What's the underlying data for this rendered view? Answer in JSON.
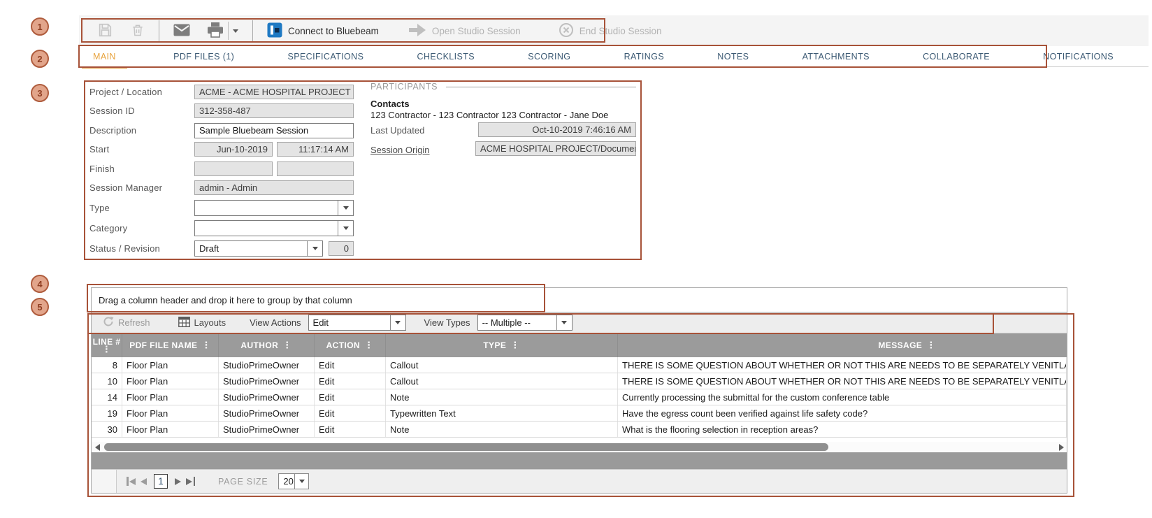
{
  "colors": {
    "accent_orange": "#E8A33D",
    "annotation_brown": "#A75238",
    "tab_inactive": "#3C5A74",
    "bluebeam_blue": "#1E79C3",
    "grid_header_gray": "#9B9B9B"
  },
  "callouts": [
    "1",
    "2",
    "3",
    "4",
    "5"
  ],
  "top_toolbar": {
    "connect_label": "Connect to Bluebeam",
    "open_label": "Open Studio Session",
    "end_label": "End Studio Session"
  },
  "tabs": {
    "items": [
      {
        "label": "MAIN",
        "active": true
      },
      {
        "label": "PDF FILES (1)"
      },
      {
        "label": "SPECIFICATIONS"
      },
      {
        "label": "CHECKLISTS"
      },
      {
        "label": "SCORING"
      },
      {
        "label": "RATINGS"
      },
      {
        "label": "NOTES"
      },
      {
        "label": "ATTACHMENTS"
      },
      {
        "label": "COLLABORATE"
      },
      {
        "label": "NOTIFICATIONS"
      }
    ]
  },
  "form": {
    "project_location": {
      "label": "Project / Location",
      "value": "ACME - ACME HOSPITAL PROJECT"
    },
    "session_id": {
      "label": "Session ID",
      "value": "312-358-487"
    },
    "description": {
      "label": "Description",
      "value": "Sample Bluebeam Session"
    },
    "start": {
      "label": "Start",
      "date": "Jun-10-2019",
      "time": "11:17:14 AM"
    },
    "finish": {
      "label": "Finish",
      "date": "",
      "time": ""
    },
    "session_manager": {
      "label": "Session Manager",
      "value": "admin - Admin"
    },
    "type": {
      "label": "Type",
      "value": ""
    },
    "category": {
      "label": "Category",
      "value": ""
    },
    "status_revision": {
      "label": "Status / Revision",
      "status": "Draft",
      "revision": "0"
    }
  },
  "participants": {
    "heading": "PARTICIPANTS",
    "contacts_label": "Contacts",
    "contacts_value": "123 Contractor - 123 Contractor 123 Contractor - Jane Doe",
    "last_updated": {
      "label": "Last Updated",
      "value": "Oct-10-2019 7:46:16 AM"
    },
    "session_origin": {
      "label": "Session Origin",
      "value": "ACME HOSPITAL PROJECT/Document Ma"
    }
  },
  "grid": {
    "group_hint": "Drag a column header and drop it here to group by that column",
    "toolbar": {
      "refresh_label": "Refresh",
      "layouts_label": "Layouts",
      "view_actions_label": "View Actions",
      "view_actions_value": "Edit",
      "view_types_label": "View Types",
      "view_types_value": "-- Multiple --"
    },
    "columns": [
      "LINE #",
      "PDF FILE NAME",
      "AUTHOR",
      "ACTION",
      "TYPE",
      "MESSAGE"
    ],
    "rows": [
      {
        "line": "8",
        "pdf": "Floor Plan",
        "author": "StudioPrimeOwner",
        "action": "Edit",
        "type": "Callout",
        "message": "THERE IS SOME QUESTION ABOUT WHETHER OR NOT THIS ARE NEEDS TO BE SEPARATELY VENITLATED"
      },
      {
        "line": "10",
        "pdf": "Floor Plan",
        "author": "StudioPrimeOwner",
        "action": "Edit",
        "type": "Callout",
        "message": "THERE IS SOME QUESTION ABOUT WHETHER OR NOT THIS ARE NEEDS TO BE SEPARATELY VENITLATED"
      },
      {
        "line": "14",
        "pdf": "Floor Plan",
        "author": "StudioPrimeOwner",
        "action": "Edit",
        "type": "Note",
        "message": "Currently processing the submittal for the custom conference table"
      },
      {
        "line": "19",
        "pdf": "Floor Plan",
        "author": "StudioPrimeOwner",
        "action": "Edit",
        "type": "Typewritten Text",
        "message": "Have the egress count been verified against life safety code?"
      },
      {
        "line": "30",
        "pdf": "Floor Plan",
        "author": "StudioPrimeOwner",
        "action": "Edit",
        "type": "Note",
        "message": "What is the flooring selection in reception areas?"
      }
    ],
    "pager": {
      "current_page": "1",
      "page_size_label": "PAGE SIZE",
      "page_size": "20"
    }
  }
}
